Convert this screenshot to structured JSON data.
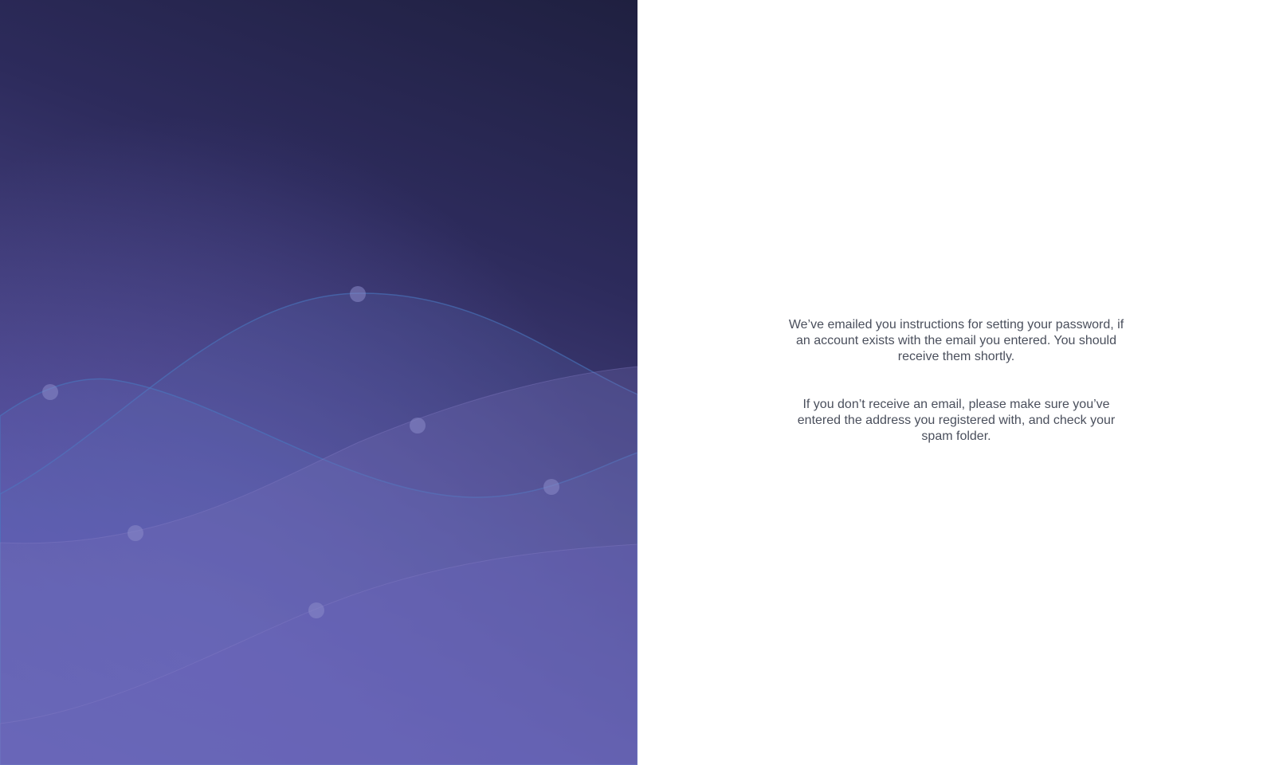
{
  "hero": {
    "colors": {
      "dark": "#1f2040",
      "mid": "#44407f",
      "light": "#6660b8",
      "wave_line": "#4a78c0",
      "dot": "#8b8ac9"
    }
  },
  "confirmation": {
    "line1": "We’ve emailed you instructions for setting your password, if an account exists with the email you entered. You should receive them shortly.",
    "line2": "If you don’t receive an email, please make sure you’ve entered the address you registered with, and check your spam folder."
  }
}
